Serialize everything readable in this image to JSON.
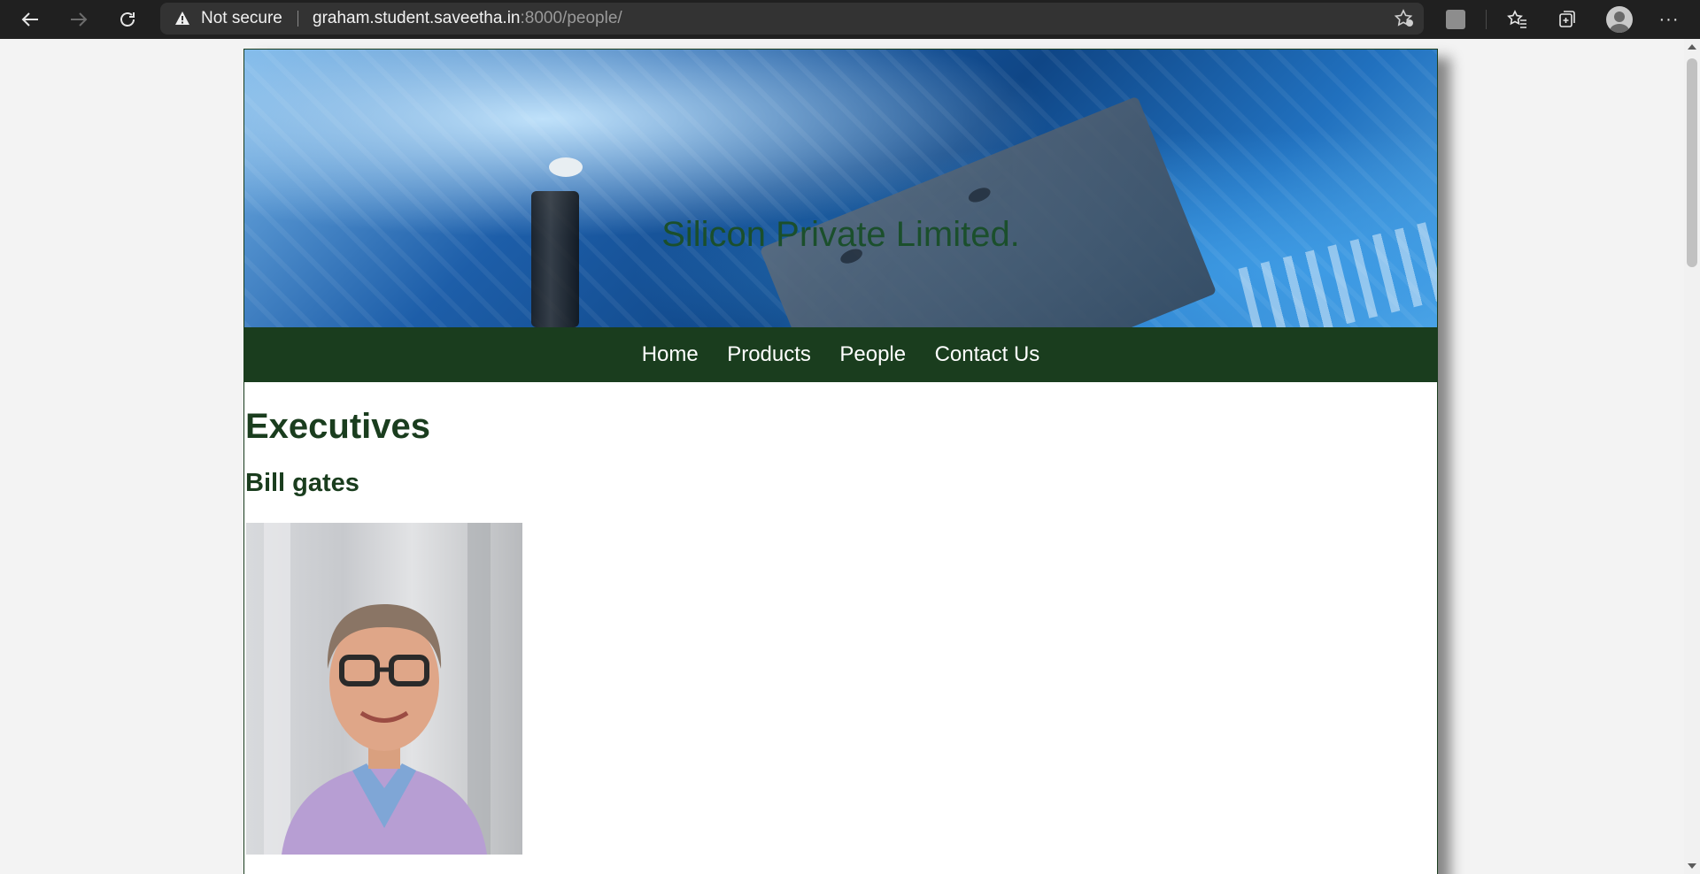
{
  "browser": {
    "security_label": "Not secure",
    "url_host": "graham.student.saveetha.in",
    "url_rest": ":8000/people/",
    "icons": [
      "back-arrow-icon",
      "forward-arrow-icon",
      "reload-icon",
      "warning-icon",
      "add-favorite-icon",
      "extension-icon",
      "favorites-icon",
      "collections-icon",
      "profile-icon",
      "more-icon"
    ]
  },
  "site": {
    "banner_title": "Silicon Private Limited.",
    "nav": [
      "Home",
      "Products",
      "People",
      "Contact Us"
    ],
    "heading": "Executives",
    "executive_name": "Bill gates"
  },
  "colors": {
    "brand_green": "#1a3d1e",
    "title_green": "#1b4f2c",
    "toolbar": "#202020"
  }
}
